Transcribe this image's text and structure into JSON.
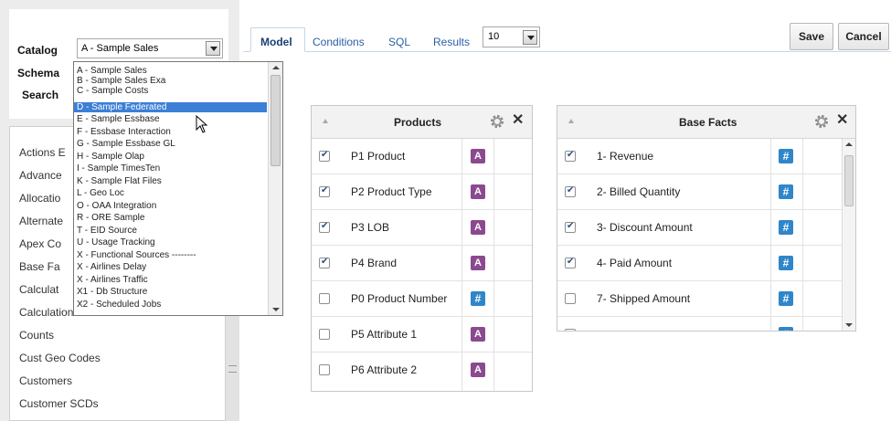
{
  "catalog_panel": {
    "catalog_label": "Catalog",
    "catalog_value": "A - Sample Sales",
    "schema_label": "Schema",
    "search_label": "Search",
    "folders": [
      "Actions E",
      "Advance",
      "Allocatio",
      "Alternate",
      "Apex Co",
      "Base Fa",
      "Calculat",
      "Calculations",
      "Counts",
      "Cust Geo Codes",
      "Customers",
      "Customer SCDs"
    ],
    "catalog_options": [
      "A - Sample Sales",
      "B - Sample Sales Exa",
      "C - Sample Costs",
      "D - Sample Federated",
      "E - Sample Essbase",
      "F - Essbase Interaction",
      "G - Sample Essbase GL",
      "H - Sample Olap",
      "I - Sample TimesTen",
      "K - Sample Flat Files",
      "L - Geo Loc",
      "O - OAA Integration",
      "R - ORE Sample",
      "T - EID Source",
      "U - Usage Tracking",
      "X - Functional Sources --------",
      "X - Airlines Delay",
      "X - Airlines Traffic",
      "X1 - Db Structure",
      "X2 - Scheduled Jobs"
    ],
    "highlighted_option": "D - Sample Federated"
  },
  "toolbar": {
    "tabs": [
      "Model",
      "Conditions",
      "SQL",
      "Results"
    ],
    "active_tab": "Model",
    "rows_value": "10",
    "save_label": "Save",
    "cancel_label": "Cancel"
  },
  "products_card": {
    "title": "Products",
    "rows": [
      {
        "label": "P1 Product",
        "checked": true,
        "type_icon": "A"
      },
      {
        "label": "P2 Product Type",
        "checked": true,
        "type_icon": "A"
      },
      {
        "label": "P3 LOB",
        "checked": true,
        "type_icon": "A"
      },
      {
        "label": "P4 Brand",
        "checked": true,
        "type_icon": "A"
      },
      {
        "label": "P0 Product Number",
        "checked": false,
        "type_icon": "#"
      },
      {
        "label": "P5 Attribute 1",
        "checked": false,
        "type_icon": "A"
      },
      {
        "label": "P6 Attribute 2",
        "checked": false,
        "type_icon": "A"
      }
    ]
  },
  "facts_card": {
    "title": "Base Facts",
    "rows": [
      {
        "label": "1- Revenue",
        "checked": true,
        "type_icon": "#"
      },
      {
        "label": "2- Billed Quantity",
        "checked": true,
        "type_icon": "#"
      },
      {
        "label": "3- Discount Amount",
        "checked": true,
        "type_icon": "#"
      },
      {
        "label": "4- Paid Amount",
        "checked": true,
        "type_icon": "#"
      },
      {
        "label": "7- Shipped Amount",
        "checked": false,
        "type_icon": "#"
      }
    ]
  },
  "colors": {
    "attribute_badge": "#8b4a8f",
    "measure_badge": "#2f86c9",
    "selection": "#3b7fd6",
    "tab_text": "#2a5fa8"
  }
}
